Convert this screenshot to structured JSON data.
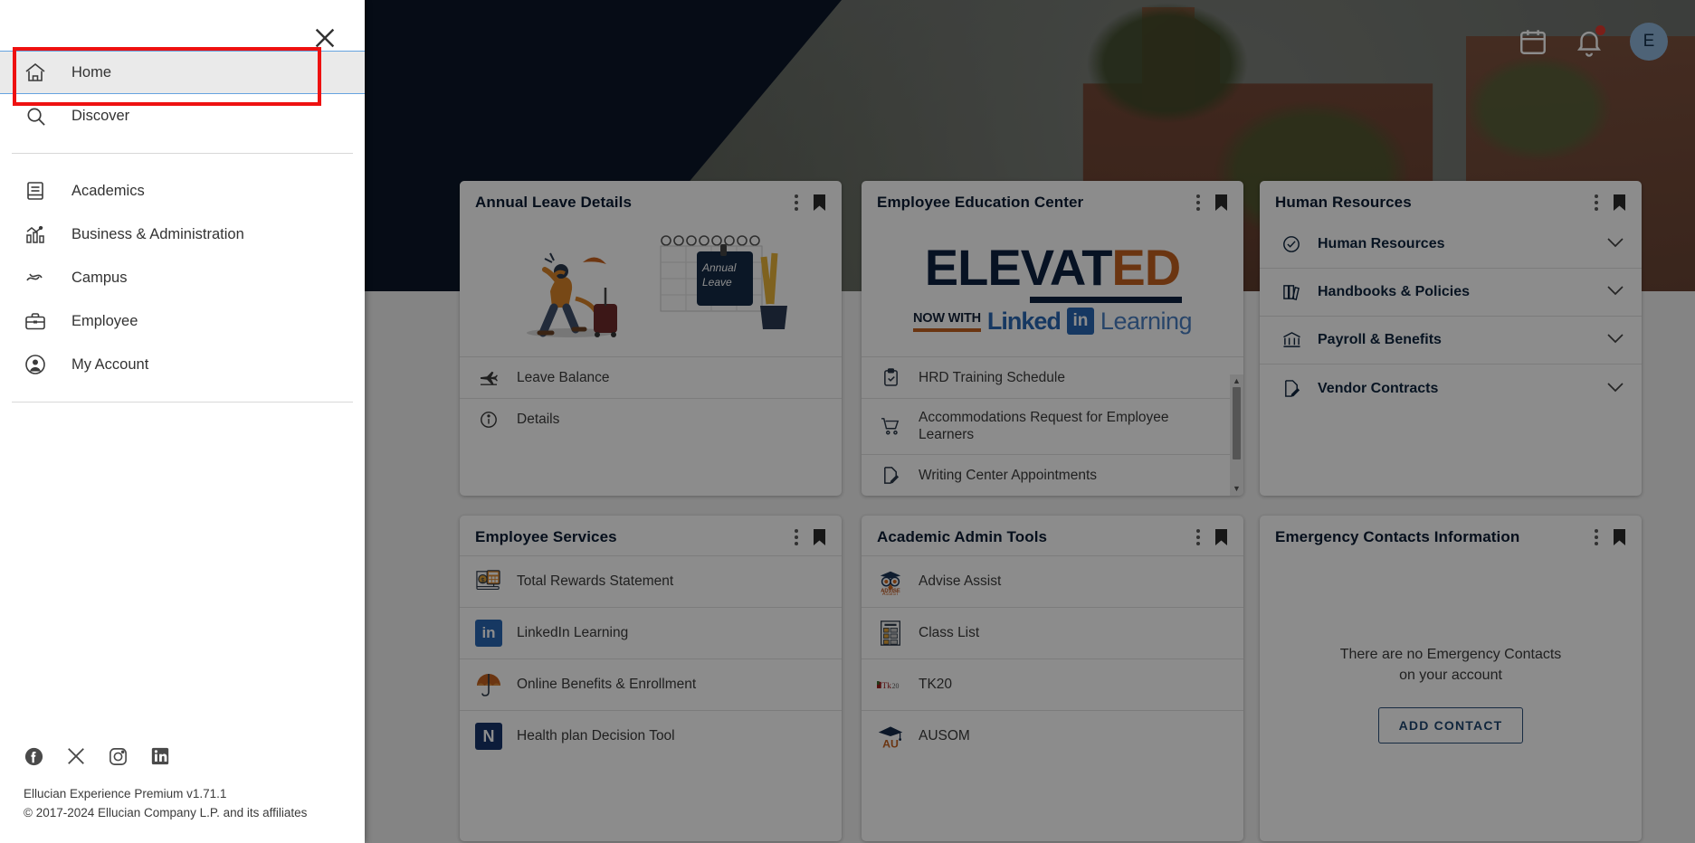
{
  "header": {
    "calendar_icon": "calendar-icon",
    "notifications_icon": "bell-icon",
    "avatar_initial": "E"
  },
  "drawer": {
    "close_label": "×",
    "primary_items": [
      {
        "label": "Home",
        "icon": "home-icon",
        "active": true
      },
      {
        "label": "Discover",
        "icon": "search-icon",
        "active": false
      }
    ],
    "section_items": [
      {
        "label": "Academics",
        "icon": "book-icon"
      },
      {
        "label": "Business & Administration",
        "icon": "chart-icon"
      },
      {
        "label": "Campus",
        "icon": "campus-icon"
      },
      {
        "label": "Employee",
        "icon": "briefcase-icon"
      },
      {
        "label": "My Account",
        "icon": "person-icon"
      }
    ],
    "socials": [
      {
        "name": "facebook-icon",
        "glyph": "f"
      },
      {
        "name": "x-twitter-icon",
        "glyph": "X"
      },
      {
        "name": "instagram-icon",
        "glyph": "◎"
      },
      {
        "name": "linkedin-icon",
        "glyph": "in"
      }
    ],
    "version_line": "Ellucian Experience Premium v1.71.1",
    "copyright_line": "© 2017-2024 Ellucian Company L.P. and its affiliates"
  },
  "cards": {
    "annual_leave": {
      "title": "Annual Leave Details",
      "illustration": "traveler-with-suitcase-and-annual-leave-calendar",
      "rows": [
        {
          "label": "Leave Balance",
          "icon": "airplane-icon"
        },
        {
          "label": "Details",
          "icon": "info-icon"
        }
      ]
    },
    "education_center": {
      "title": "Employee Education Center",
      "logo": {
        "elevat": "ELEVAT",
        "ed": "ED",
        "now_with": "NOW WITH",
        "linked": "Linked",
        "in": "in",
        "learning": "Learning"
      },
      "rows": [
        {
          "label": "HRD Training Schedule",
          "icon": "clipboard-check-icon"
        },
        {
          "label": "Accommodations Request for Employee Learners",
          "icon": "cart-icon"
        },
        {
          "label": "Writing Center Appointments",
          "icon": "document-edit-icon"
        }
      ]
    },
    "human_resources": {
      "title": "Human Resources",
      "rows": [
        {
          "label": "Human Resources",
          "icon": "check-circle-icon",
          "chevron": "chevron-down-icon"
        },
        {
          "label": "Handbooks & Policies",
          "icon": "books-icon",
          "chevron": "chevron-down-icon"
        },
        {
          "label": "Payroll & Benefits",
          "icon": "bank-icon",
          "chevron": "chevron-down-icon"
        },
        {
          "label": "Vendor Contracts",
          "icon": "contract-icon",
          "chevron": "chevron-down-icon"
        }
      ]
    },
    "employee_services": {
      "title": "Employee Services",
      "rows": [
        {
          "label": "Total Rewards Statement",
          "icon": "rewards-statement-icon"
        },
        {
          "label": "LinkedIn Learning",
          "icon": "linkedin-icon"
        },
        {
          "label": "Online Benefits & Enrollment",
          "icon": "umbrella-icon"
        },
        {
          "label": "Health plan Decision Tool",
          "icon": "navigate-n-icon"
        }
      ]
    },
    "academic_admin_tools": {
      "title": "Academic Admin Tools",
      "rows": [
        {
          "label": "Advise Assist",
          "icon": "advise-assist-owl-icon"
        },
        {
          "label": "Class List",
          "icon": "class-list-icon"
        },
        {
          "label": "TK20",
          "icon": "tk20-icon"
        },
        {
          "label": "AUSOM",
          "icon": "ausom-grad-cap-icon"
        }
      ]
    },
    "emergency_contacts": {
      "title": "Emergency Contacts Information",
      "empty_line1": "There are no Emergency Contacts",
      "empty_line2": "on your account",
      "add_button": "ADD CONTACT"
    },
    "left_partial_top": {
      "lock_icon": "lock-icon"
    },
    "left_partial_bottom": {
      "kebab_icon": "more-vertical-icon",
      "bookmark_icon": "bookmark-icon"
    }
  },
  "colors": {
    "navy": "#0c1729",
    "accent_orange": "#c4621f",
    "linkedin_blue": "#2867b2",
    "highlight_red": "#ee1111",
    "active_blue": "#66a3e0"
  }
}
